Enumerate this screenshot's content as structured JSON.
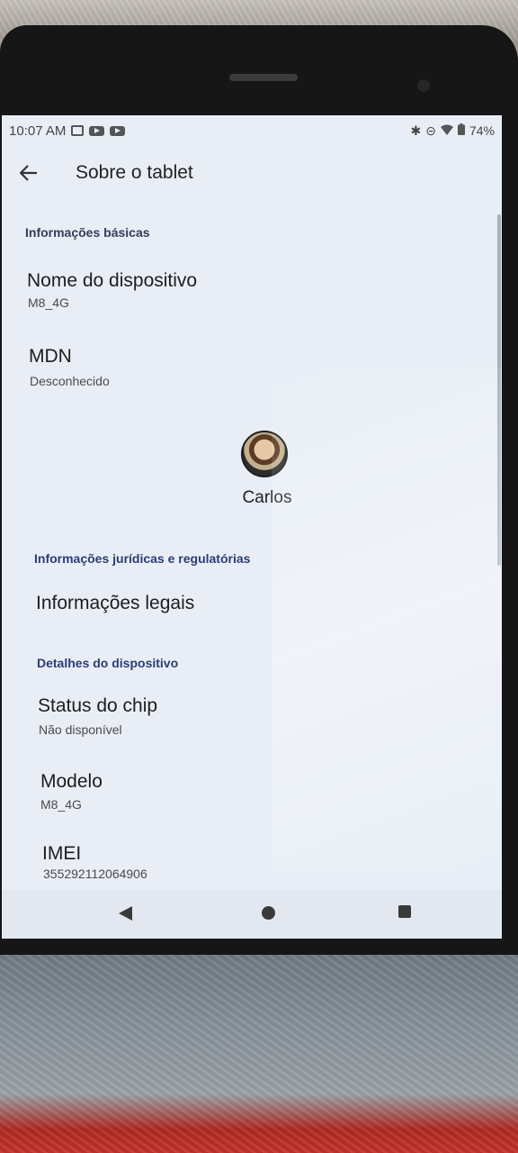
{
  "status_bar": {
    "time": "10:07 AM",
    "battery": "74%",
    "icons": [
      "notification-box-icon",
      "youtube-icon",
      "youtube-icon",
      "bluetooth-icon",
      "do-not-disturb-icon",
      "wifi-icon",
      "battery-icon"
    ]
  },
  "app_bar": {
    "title": "Sobre o tablet"
  },
  "sections": {
    "basic": {
      "header": "Informações básicas",
      "device_name_title": "Nome do dispositivo",
      "device_name_value": "M8_4G",
      "mdn_title": "MDN",
      "mdn_value": "Desconhecido"
    },
    "profile": {
      "name": "Carlos"
    },
    "legal": {
      "header": "Informações jurídicas e regulatórias",
      "legal_info_title": "Informações legais"
    },
    "device_details": {
      "header": "Detalhes do dispositivo",
      "sim_status_title": "Status do chip",
      "sim_status_value": "Não disponível",
      "model_title": "Modelo",
      "model_value": "M8_4G",
      "imei_title": "IMEI",
      "imei_value": "355292112064906"
    }
  },
  "colors": {
    "screen_bg": "#e9eef6",
    "accent_header": "#2a3d73"
  }
}
